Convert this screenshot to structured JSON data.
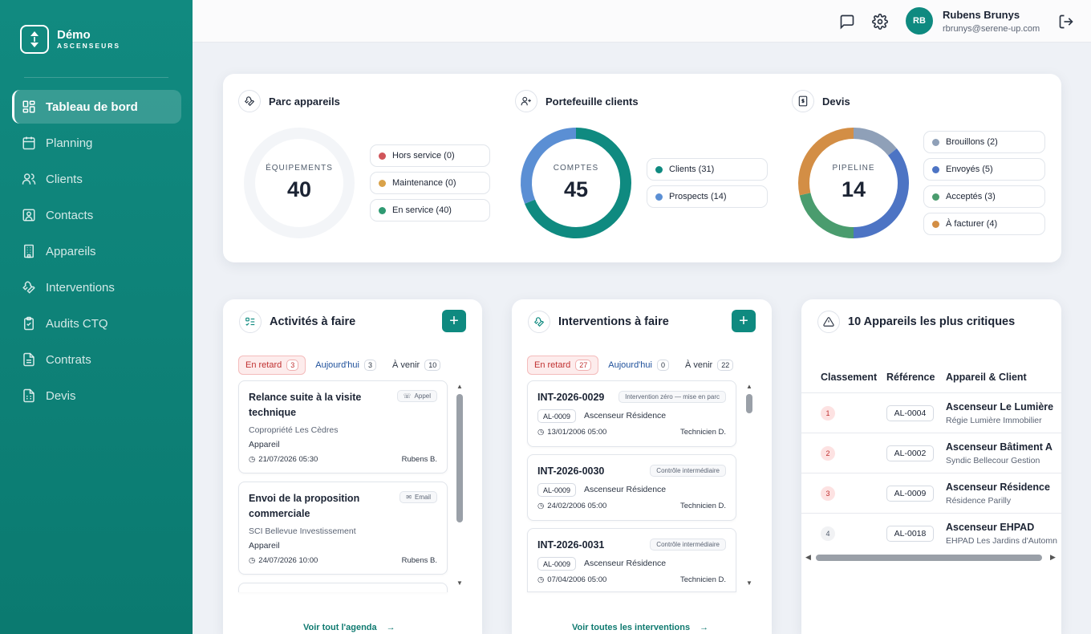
{
  "brand": {
    "name": "Démo",
    "sub": "ASCENSEURS"
  },
  "nav": [
    {
      "label": "Tableau de bord",
      "icon": "dashboard-icon",
      "active": true
    },
    {
      "label": "Planning",
      "icon": "calendar-icon"
    },
    {
      "label": "Clients",
      "icon": "users-icon"
    },
    {
      "label": "Contacts",
      "icon": "contact-card-icon"
    },
    {
      "label": "Appareils",
      "icon": "building-icon"
    },
    {
      "label": "Interventions",
      "icon": "wrench-icon"
    },
    {
      "label": "Audits CTQ",
      "icon": "clipboard-check-icon"
    },
    {
      "label": "Contrats",
      "icon": "file-text-icon"
    },
    {
      "label": "Devis",
      "icon": "file-spreadsheet-icon"
    }
  ],
  "user": {
    "initials": "RB",
    "name": "Rubens Brunys",
    "email": "rbrunys@serene-up.com"
  },
  "stats": {
    "parc": {
      "title": "Parc appareils",
      "caption": "ÉQUIPEMENTS",
      "total": "40",
      "legend": [
        {
          "label": "Hors service (0)",
          "color": "#d0555a"
        },
        {
          "label": "Maintenance (0)",
          "color": "#d9a24a"
        },
        {
          "label": "En service (40)",
          "color": "#2f9a72"
        }
      ]
    },
    "clients": {
      "title": "Portefeuille clients",
      "caption": "COMPTES",
      "total": "45",
      "legend": [
        {
          "label": "Clients (31)",
          "color": "#0f8a80"
        },
        {
          "label": "Prospects (14)",
          "color": "#5b8fd4"
        }
      ]
    },
    "devis": {
      "title": "Devis",
      "caption": "PIPELINE",
      "total": "14",
      "legend": [
        {
          "label": "Brouillons (2)",
          "color": "#8fa0b8"
        },
        {
          "label": "Envoyés (5)",
          "color": "#4d74c4"
        },
        {
          "label": "Acceptés (3)",
          "color": "#4a9c6e"
        },
        {
          "label": "À facturer (4)",
          "color": "#d38e45"
        }
      ]
    }
  },
  "chart_data": [
    {
      "type": "pie",
      "title": "Parc appareils",
      "categories": [
        "Hors service",
        "Maintenance",
        "En service"
      ],
      "values": [
        0,
        0,
        40
      ]
    },
    {
      "type": "pie",
      "title": "Portefeuille clients",
      "categories": [
        "Clients",
        "Prospects"
      ],
      "values": [
        31,
        14
      ],
      "colors": [
        "#0f8a80",
        "#5b8fd4"
      ]
    },
    {
      "type": "pie",
      "title": "Devis",
      "categories": [
        "Brouillons",
        "Envoyés",
        "Acceptés",
        "À facturer"
      ],
      "values": [
        2,
        5,
        3,
        4
      ],
      "colors": [
        "#8fa0b8",
        "#4d74c4",
        "#4a9c6e",
        "#d38e45"
      ]
    }
  ],
  "activities": {
    "title": "Activités à faire",
    "tabs": [
      {
        "label": "En retard",
        "count": "3"
      },
      {
        "label": "Aujourd'hui",
        "count": "3"
      },
      {
        "label": "À venir",
        "count": "10"
      }
    ],
    "items": [
      {
        "title1": "Relance suite à la visite",
        "title2": "technique",
        "tag": "Appel",
        "line": "Copropriété Les Cèdres",
        "strong": "Appareil",
        "date": "21/07/2026 05:30",
        "who": "Rubens B."
      },
      {
        "title1": "Envoi de la proposition",
        "title2": "commerciale",
        "tag": "Email",
        "line": "SCI Bellevue Investissement",
        "strong": "Appareil",
        "date": "24/07/2026 10:00",
        "who": "Rubens B."
      }
    ],
    "footer": "Voir tout l'agenda"
  },
  "interventions": {
    "title": "Interventions à faire",
    "tabs": [
      {
        "label": "En retard",
        "count": "27"
      },
      {
        "label": "Aujourd'hui",
        "count": "0"
      },
      {
        "label": "À venir",
        "count": "22"
      }
    ],
    "items": [
      {
        "ref": "INT-2026-0029",
        "tag": "Intervention zéro — mise en parc",
        "chip": "AL-0009",
        "device": "Ascenseur Résidence",
        "date": "13/01/2006 05:00",
        "who": "Technicien D."
      },
      {
        "ref": "INT-2026-0030",
        "tag": "Contrôle intermédiaire",
        "chip": "AL-0009",
        "device": "Ascenseur Résidence",
        "date": "24/02/2006 05:00",
        "who": "Technicien D."
      },
      {
        "ref": "INT-2026-0031",
        "tag": "Contrôle intermédiaire",
        "chip": "AL-0009",
        "device": "Ascenseur Résidence",
        "date": "07/04/2006 05:00",
        "who": "Technicien D."
      }
    ],
    "footer": "Voir toutes les interventions"
  },
  "critical": {
    "title": "10 Appareils les plus critiques",
    "columns": [
      "Classement",
      "Référence",
      "Appareil & Client"
    ],
    "rows": [
      {
        "rank": "1",
        "ref": "AL-0004",
        "name": "Ascenseur Le Lumière",
        "client": "Régie Lumière Immobilier"
      },
      {
        "rank": "2",
        "ref": "AL-0002",
        "name": "Ascenseur Bâtiment A",
        "client": "Syndic Bellecour Gestion"
      },
      {
        "rank": "3",
        "ref": "AL-0009",
        "name": "Ascenseur Résidence",
        "client": "Résidence Parilly"
      },
      {
        "rank": "4",
        "ref": "AL-0018",
        "name": "Ascenseur EHPAD",
        "client": "EHPAD Les Jardins d'Automn"
      }
    ]
  }
}
